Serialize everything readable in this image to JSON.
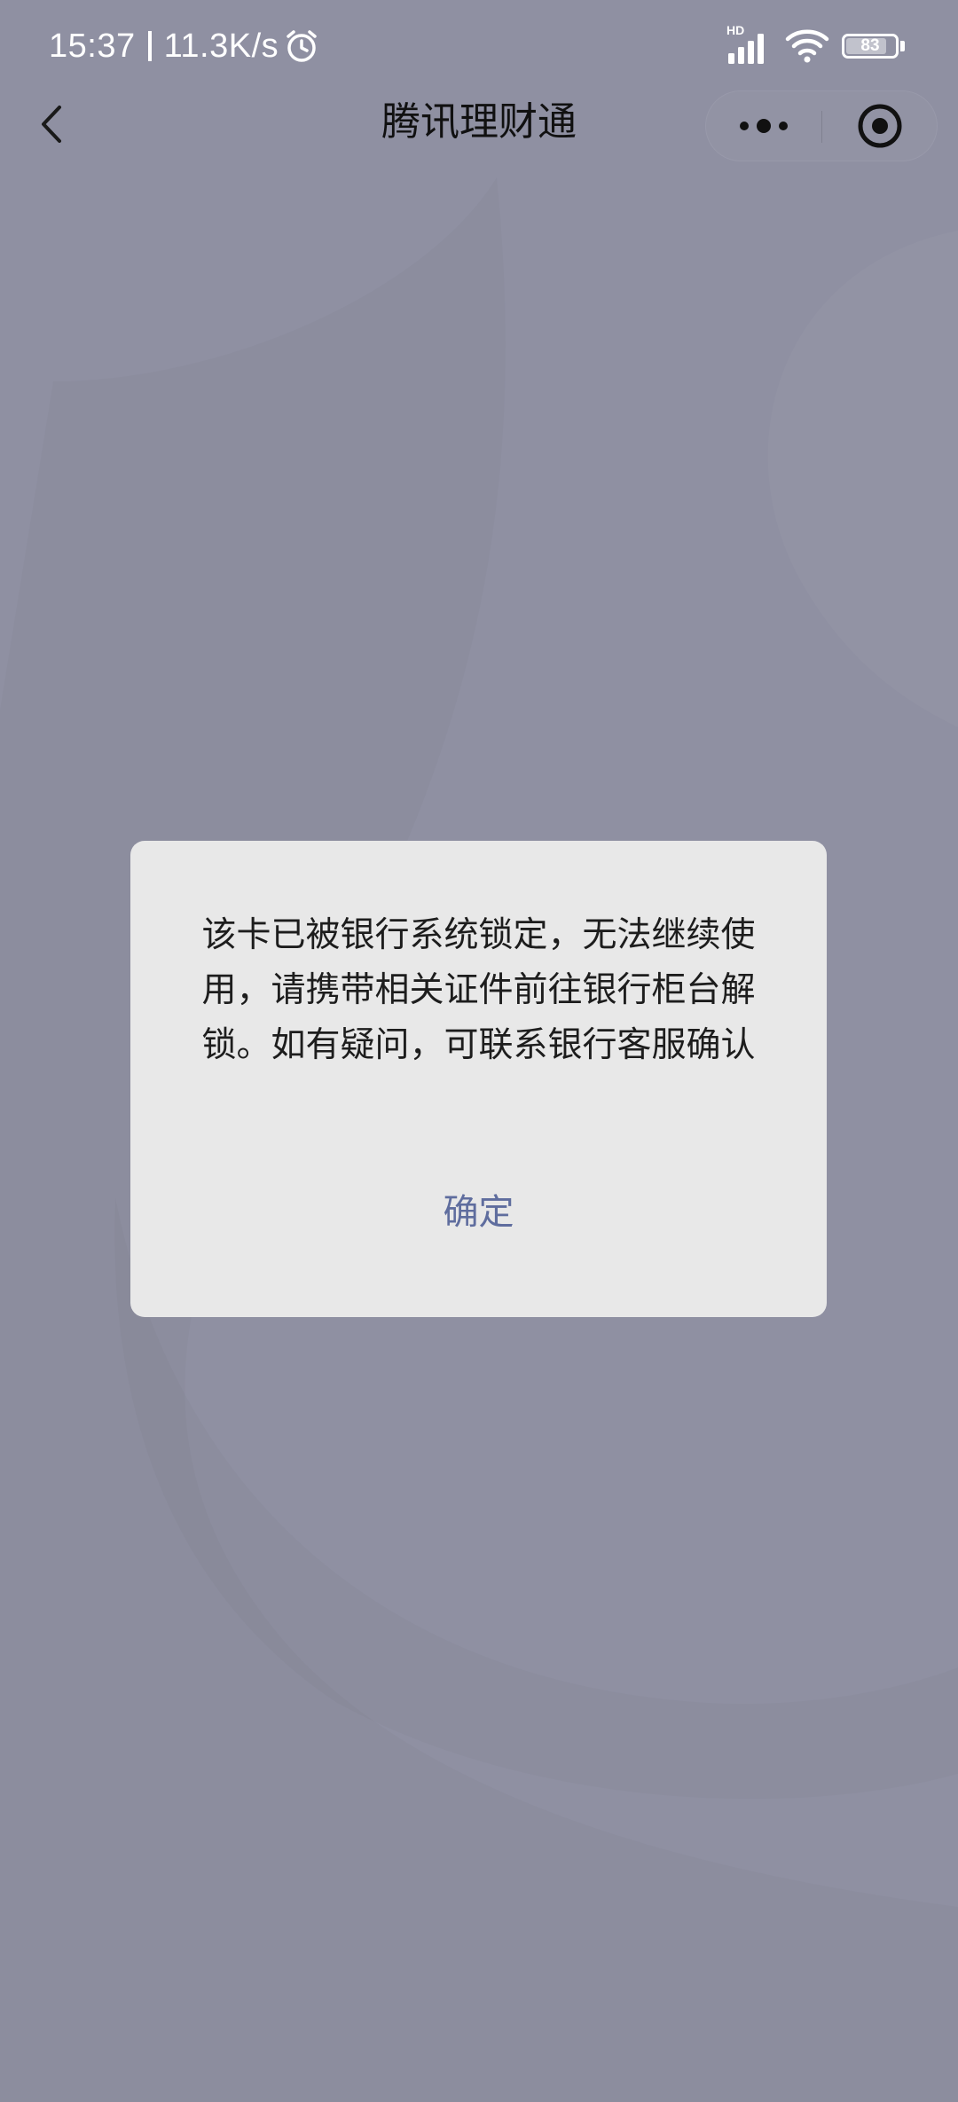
{
  "status_bar": {
    "time": "15:37",
    "speed": "11.3K/s",
    "network_label": "HD",
    "battery": "83",
    "battery_level": 0.83,
    "icons": [
      "alarm-icon",
      "signal-icon",
      "wifi-icon",
      "battery-icon"
    ]
  },
  "nav": {
    "title": "腾讯理财通",
    "icons": [
      "back-icon",
      "more-icon",
      "close-target-icon"
    ]
  },
  "dialog": {
    "message": "该卡已被银行系统锁定，无法继续使用，请携带相关证件前往银行柜台解锁。如有疑问，可联系银行客服确认",
    "confirm_label": "确定"
  },
  "colors": {
    "background": "#8f90a2",
    "dialog_background": "#e8e8e8",
    "confirm_text": "#5f6d9e"
  }
}
